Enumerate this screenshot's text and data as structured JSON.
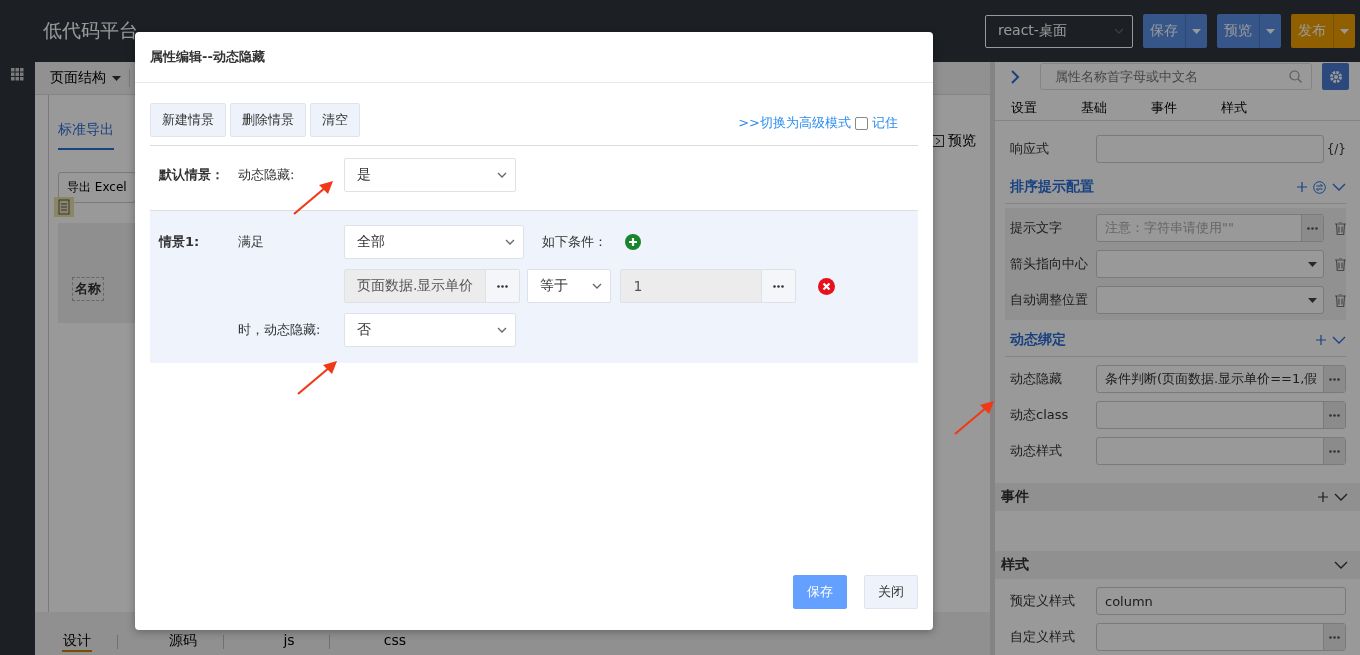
{
  "header": {
    "logo": "低代码平台",
    "platform_select": "react-桌面",
    "actions": [
      {
        "label": "保存",
        "kind": "blue"
      },
      {
        "label": "预览",
        "kind": "blue"
      },
      {
        "label": "发布",
        "kind": "orange"
      }
    ]
  },
  "toolbar": {
    "structure_menu": "页面结构"
  },
  "canvas": {
    "tab": "标准导出",
    "export_button": "导出 Excel",
    "column_header": "名称",
    "preview": "预览"
  },
  "bottom_tabs": [
    {
      "label": "设计",
      "selected": true
    },
    {
      "label": "源码",
      "selected": false
    },
    {
      "label": "js",
      "selected": false
    },
    {
      "label": "css",
      "selected": false
    }
  ],
  "properties": {
    "search_placeholder": "属性名称首字母或中文名",
    "tabs": [
      "设置",
      "基础",
      "事件",
      "样式"
    ],
    "top_rows": [
      {
        "label": "响应式",
        "kind": "expr",
        "suffix": "{/}",
        "deletable": false
      }
    ],
    "sections": [
      {
        "title": "排序提示配置",
        "kind": "link",
        "add": true,
        "swap": true,
        "boxed": true,
        "rows": [
          {
            "label": "提示文字",
            "kind": "ref",
            "placeholder": "注意：字符串请使用\"\"",
            "deletable": true
          },
          {
            "label": "箭头指向中心",
            "kind": "select",
            "deletable": true
          },
          {
            "label": "自动调整位置",
            "kind": "select",
            "deletable": true
          }
        ]
      },
      {
        "title": "动态绑定",
        "kind": "link",
        "add": true,
        "swap": false,
        "boxed": false,
        "rows": [
          {
            "label": "动态隐藏",
            "kind": "ref",
            "value": "条件判断(页面数据.显示单价==1,假",
            "deletable": false
          },
          {
            "label": "动态class",
            "kind": "ref",
            "deletable": false
          },
          {
            "label": "动态样式",
            "kind": "ref",
            "deletable": false
          }
        ]
      },
      {
        "title": "事件",
        "kind": "bar",
        "add": true,
        "swap": false,
        "boxed": false
      },
      {
        "title": "样式",
        "kind": "bar",
        "add": false,
        "swap": false,
        "boxed": false,
        "rows": [
          {
            "label": "预定义样式",
            "kind": "input",
            "value": "column",
            "deletable": false
          },
          {
            "label": "自定义样式",
            "kind": "ref",
            "deletable": false
          }
        ]
      }
    ]
  },
  "dialog": {
    "title": "属性编辑--动态隐藏",
    "toolbar_buttons": [
      "新建情景",
      "删除情景",
      "清空"
    ],
    "advanced_link": ">>切换为高级模式",
    "remember": {
      "label": "记住",
      "checked": false
    },
    "default": {
      "label": "默认情景：",
      "field_label": "动态隐藏:",
      "value": "是"
    },
    "scenarios": [
      {
        "label": "情景1:",
        "match_label": "满足",
        "match": "全部",
        "condition_label": "如下条件：",
        "conditions": [
          {
            "field": "页面数据.显示单价",
            "operator": "等于",
            "value": "1"
          }
        ],
        "result_label": "时，动态隐藏:",
        "result": "否"
      }
    ],
    "footer_buttons": [
      {
        "label": "保存",
        "kind": "primary"
      },
      {
        "label": "关闭",
        "kind": "default"
      }
    ]
  }
}
